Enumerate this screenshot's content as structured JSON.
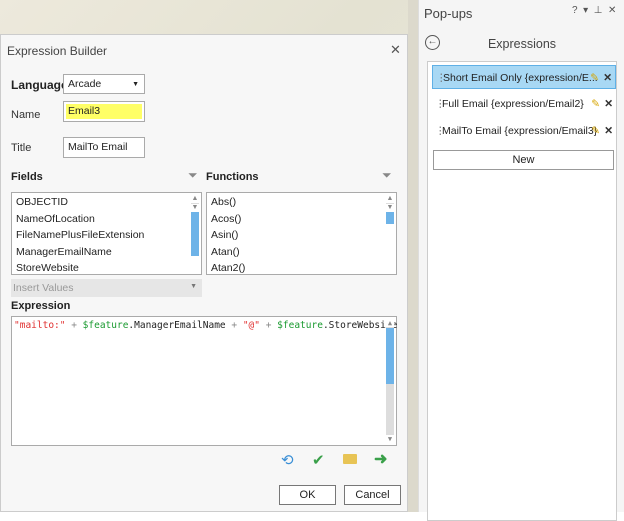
{
  "dialog": {
    "title": "Expression Builder",
    "language_label": "Language",
    "language_value": "Arcade",
    "name_label": "Name",
    "name_value": "Email3",
    "title_label": "Title",
    "title_value": "MailTo Email",
    "fields_label": "Fields",
    "fields": [
      "OBJECTID",
      "NameOfLocation",
      "FileNamePlusFileExtension",
      "ManagerEmailName",
      "StoreWebsite"
    ],
    "functions_label": "Functions",
    "functions": [
      "Abs()",
      "Acos()",
      "Asin()",
      "Atan()",
      "Atan2()"
    ],
    "insert_values": "Insert Values",
    "expression_label": "Expression",
    "expression": {
      "s1": "\"mailto:\"",
      "p1": " + ",
      "v1": "$feature",
      "f1": ".ManagerEmailName",
      "p2": " + ",
      "s2": "\"@\"",
      "p3": " + ",
      "v2": "$feature",
      "f2": ".StoreWebsite"
    },
    "ok": "OK",
    "cancel": "Cancel",
    "highlight_color": "#ffff66"
  },
  "panel": {
    "title": "Pop-ups",
    "controls": {
      "help": "?",
      "menu": "▾",
      "pin": "⊥",
      "close": "✕"
    },
    "heading": "Expressions",
    "items": [
      {
        "label": "Short Email Only {expression/E...",
        "selected": true
      },
      {
        "label": "Full Email {expression/Email2}",
        "selected": false
      },
      {
        "label": "MailTo Email {expression/Email3}",
        "selected": false
      }
    ],
    "new_label": "New",
    "selected_color": "#a8d8f4"
  }
}
